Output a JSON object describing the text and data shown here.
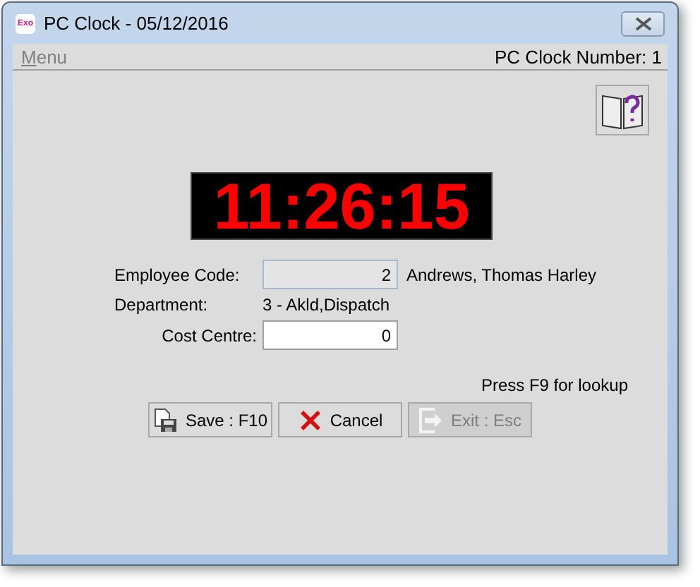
{
  "window": {
    "title": "PC Clock - 05/12/2016",
    "app_icon": "Exo"
  },
  "menu_bar": {
    "menu": "Menu",
    "clock_number": "PC Clock Number: 1"
  },
  "clock": {
    "time": "11:26:15"
  },
  "fields": [
    {
      "kind": "input",
      "label": "Employee Code:",
      "value": "2",
      "disabled": true,
      "note": "Andrews, Thomas Harley"
    },
    {
      "kind": "text",
      "label": "Department:",
      "value": "3 - Akld,Dispatch"
    },
    {
      "kind": "input",
      "label": "Cost Centre:",
      "value": "0",
      "disabled": false
    }
  ],
  "hint": "Press F9 for lookup",
  "buttons": [
    {
      "kind": "save",
      "label": "Save : F10",
      "disabled": false
    },
    {
      "kind": "cancel",
      "label": "Cancel",
      "disabled": false
    },
    {
      "kind": "exit",
      "label": "Exit : Esc",
      "disabled": true
    }
  ]
}
